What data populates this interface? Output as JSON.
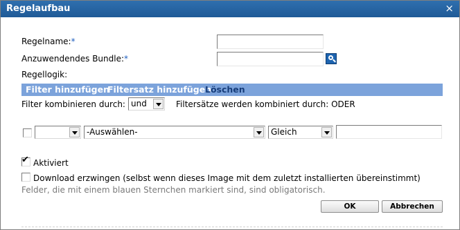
{
  "dialog": {
    "title": "Regelaufbau",
    "close_glyph": "×"
  },
  "form": {
    "rule_name_label": "Regelname:",
    "rule_name_required": "*",
    "rule_name_value": "",
    "bundle_label": "Anzuwendendes Bundle:",
    "bundle_required": "*",
    "bundle_value": "",
    "browse_icon": "search-icon",
    "rule_logic_label": "Regellogik:"
  },
  "toolbar": {
    "add_filter": "Filter hinzufügen",
    "add_filter_set": "Filtersatz hinzufügen",
    "delete": "Löschen"
  },
  "combine": {
    "filter_label": "Filter kombinieren durch:",
    "filter_value": "und",
    "sets_text": "Filtersätze werden kombiniert durch: ODER"
  },
  "filter_row": {
    "checked": false,
    "first_select_value": "",
    "condition_value": "-Auswählen-",
    "operator_value": "Gleich",
    "value": ""
  },
  "options": {
    "enabled_label": "Aktiviert",
    "enabled_checked": true,
    "force_download_label": "Download erzwingen (selbst wenn dieses Image mit dem zuletzt installierten übereinstimmt)",
    "force_download_checked": false
  },
  "note": "Felder, die mit einem blauen Sternchen markiert sind, sind obligatorisch.",
  "buttons": {
    "ok": "OK",
    "cancel": "Abbrechen"
  },
  "colors": {
    "titlebar": "#1f5a97",
    "toolbar": "#7ca3db",
    "required": "#1f5fbf"
  }
}
